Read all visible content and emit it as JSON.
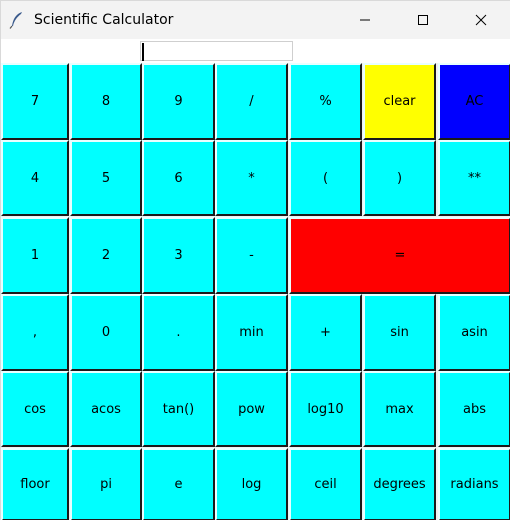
{
  "window": {
    "title": "Scientific Calculator",
    "icon": "feather-icon",
    "controls": {
      "minimize": "minimize-icon",
      "maximize": "maximize-icon",
      "close": "close-icon"
    }
  },
  "display": {
    "value": ""
  },
  "colors": {
    "key": "#00ffff",
    "clear": "#ffff00",
    "ac": "#0000ff",
    "equals": "#ff0000"
  },
  "keys": {
    "r1": [
      "7",
      "8",
      "9",
      "/",
      "%",
      "clear",
      "AC"
    ],
    "r2": [
      "4",
      "5",
      "6",
      "*",
      "(",
      ")",
      "**"
    ],
    "r3": [
      "1",
      "2",
      "3",
      "-",
      "="
    ],
    "r4": [
      ",",
      "0",
      ".",
      "min",
      "+",
      "sin",
      "asin"
    ],
    "r5": [
      "cos",
      "acos",
      "tan()",
      "pow",
      "log10",
      "max",
      "abs"
    ],
    "r6": [
      "floor",
      "pi",
      "e",
      "log",
      "ceil",
      "degrees",
      "radians"
    ]
  }
}
